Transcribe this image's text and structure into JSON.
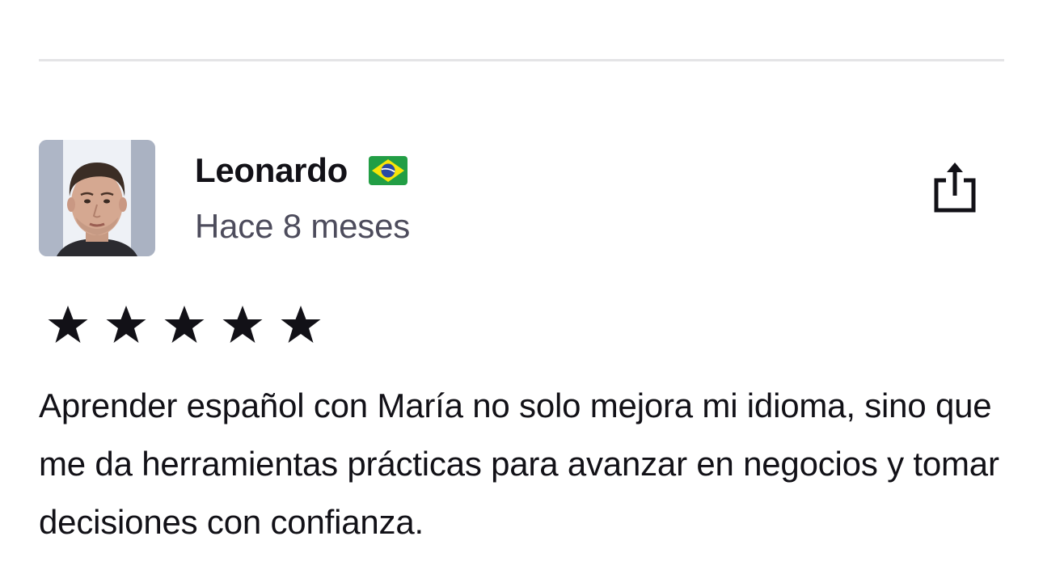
{
  "review": {
    "reviewer_name": "Leonardo",
    "country_flag_icon": "brazil-flag-icon",
    "time_ago": "Hace 8 meses",
    "rating": 5,
    "rating_max": 5,
    "text": "Aprender español con María no solo mejora mi idioma, sino que me da herramientas prácticas para avanzar en negocios y tomar decisiones con confianza.",
    "share_icon": "share-icon"
  },
  "colors": {
    "text_primary": "#121117",
    "text_secondary": "#4d4c5c",
    "divider": "#e4e4e6",
    "star": "#121117"
  }
}
